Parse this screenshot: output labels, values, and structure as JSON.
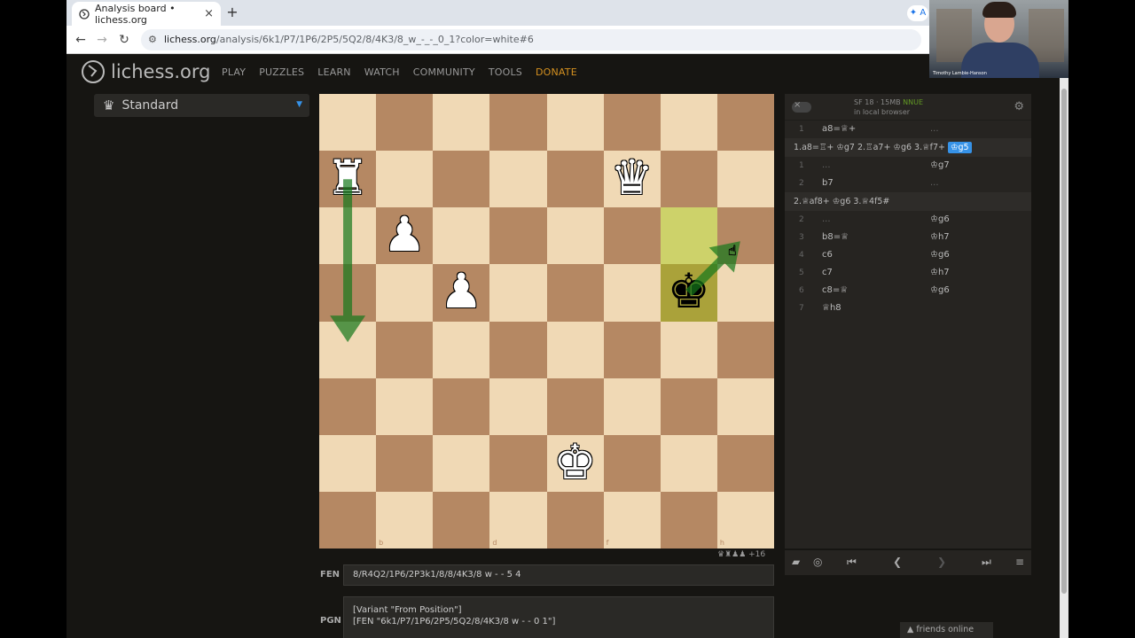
{
  "browser": {
    "tab_title": "Analysis board • lichess.org",
    "tab_close": "×",
    "new_tab": "+",
    "right_badge": "✦ A",
    "url_host": "lichess.org",
    "url_path": "/analysis/6k1/P7/1P6/2P5/5Q2/8/4K3/8_w_-_-_0_1?color=white#6"
  },
  "site": {
    "logo_text": "lichess.org",
    "nav": [
      "PLAY",
      "PUZZLES",
      "LEARN",
      "WATCH",
      "COMMUNITY",
      "TOOLS",
      "DONATE"
    ],
    "variant": "Standard"
  },
  "board": {
    "files": [
      "a",
      "b",
      "c",
      "d",
      "e",
      "f",
      "g",
      "h"
    ],
    "ranks": [
      "8",
      "7",
      "6",
      "5",
      "4",
      "3",
      "2",
      "1"
    ],
    "pieces": [
      {
        "square": "a7",
        "glyph": "♜",
        "color": "w"
      },
      {
        "square": "f7",
        "glyph": "♛",
        "color": "w"
      },
      {
        "square": "b6",
        "glyph": "♟",
        "color": "w"
      },
      {
        "square": "c5",
        "glyph": "♟",
        "color": "w"
      },
      {
        "square": "g5",
        "glyph": "♚",
        "color": "b"
      },
      {
        "square": "e2",
        "glyph": "♚",
        "color": "w"
      }
    ],
    "highlights": [
      "g6",
      "g5"
    ],
    "arrows": [
      [
        "a7",
        "a4"
      ],
      [
        "g5",
        "h6"
      ]
    ],
    "arrow_color": "#15781B",
    "material": "♛♜♟♟ +16"
  },
  "fen": {
    "label": "FEN",
    "value": "8/R4Q2/1P6/2P3k1/8/8/4K3/8 w - - 5 4"
  },
  "pgn": {
    "label": "PGN",
    "line1": "[Variant \"From Position\"]",
    "line2": "[FEN \"6k1/P7/1P6/2P5/5Q2/8/4K3/8 w - - 0 1\"]"
  },
  "engine": {
    "name": "SF 18 · 15MB",
    "nnue": "NNUE",
    "location": "in local browser",
    "gear": "⚙",
    "rows_a": [
      {
        "idx": "1",
        "w": "a8=♕+",
        "b": "..."
      }
    ],
    "variation1": {
      "prefix": "1.a8=♖+ ♔g7 2.♖a7+ ♔g6 3.♕f7+",
      "active": "♔g5"
    },
    "rows_b": [
      {
        "idx": "1",
        "w": "...",
        "b": "♔g7"
      },
      {
        "idx": "2",
        "w": "b7",
        "b": "..."
      }
    ],
    "variation2": "2.♕af8+ ♔g6 3.♕4f5#",
    "rows_c": [
      {
        "idx": "2",
        "w": "...",
        "b": "♔g6"
      },
      {
        "idx": "3",
        "w": "b8=♕",
        "b": "♔h7"
      },
      {
        "idx": "4",
        "w": "c6",
        "b": "♔g6"
      },
      {
        "idx": "5",
        "w": "c7",
        "b": "♔h7"
      },
      {
        "idx": "6",
        "w": "c8=♕",
        "b": "♔g6"
      },
      {
        "idx": "7",
        "w": "♕h8",
        "b": ""
      }
    ]
  },
  "controls": {
    "book": "▰",
    "target": "◎",
    "first": "⏮",
    "prev": "❮",
    "next": "❯",
    "last": "⏭",
    "menu": "≡"
  },
  "webcam": {
    "name_tag": "Timothy Lambie-Hanson"
  },
  "friends": "▲ friends online"
}
